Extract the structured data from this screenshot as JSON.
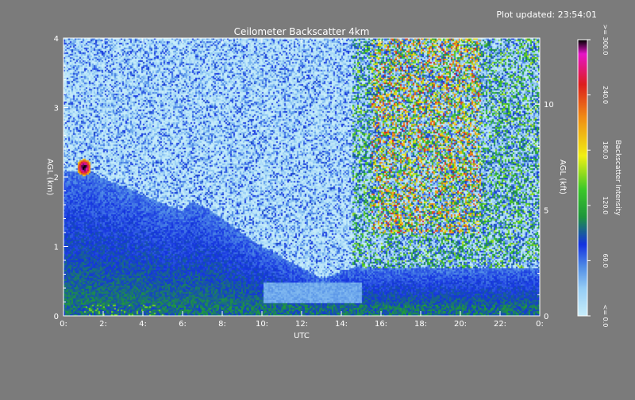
{
  "header": {
    "updated": "Plot updated: 23:54:01"
  },
  "chart_data": {
    "type": "heatmap",
    "title": "Ceilometer Backscatter 4km",
    "xlabel": "UTC",
    "ylabel_left": "AGL (km)",
    "ylabel_right": "AGL (kft)",
    "colorbar_label": "Backscatter Intensity",
    "x_range": [
      0,
      24
    ],
    "y_range_km": [
      0,
      4
    ],
    "y_range_kft": [
      0,
      13.12
    ],
    "x_ticks": [
      "0:",
      "2:",
      "4:",
      "6:",
      "8:",
      "10:",
      "12:",
      "14:",
      "16:",
      "18:",
      "20:",
      "22:",
      "0:"
    ],
    "x_tick_values": [
      0,
      2,
      4,
      6,
      8,
      10,
      12,
      14,
      16,
      18,
      20,
      22,
      24
    ],
    "y_ticks_left": [
      "0",
      "1",
      "2",
      "3",
      "4"
    ],
    "y_tick_values_left": [
      0,
      1,
      2,
      3,
      4
    ],
    "y_ticks_right": [
      "0",
      "5",
      "10"
    ],
    "y_tick_values_right": [
      0,
      5,
      10
    ],
    "colorbar_ticks": [
      "<= 0.0",
      "60.0",
      "120.0",
      "180.0",
      "240.0",
      ">= 300.0"
    ],
    "colorbar_tick_values": [
      0,
      60,
      120,
      180,
      240,
      300
    ],
    "colorbar_range": [
      0,
      300
    ],
    "colors": {
      "background": "#7b7b7b",
      "axis": "#ffffff",
      "low": "#c8eefa",
      "mid_low": "#3a6ee0",
      "mid": "#1030e0",
      "mid_high": "#28b428",
      "high": "#f0f000",
      "higher": "#e02020",
      "max": "#000000"
    }
  }
}
